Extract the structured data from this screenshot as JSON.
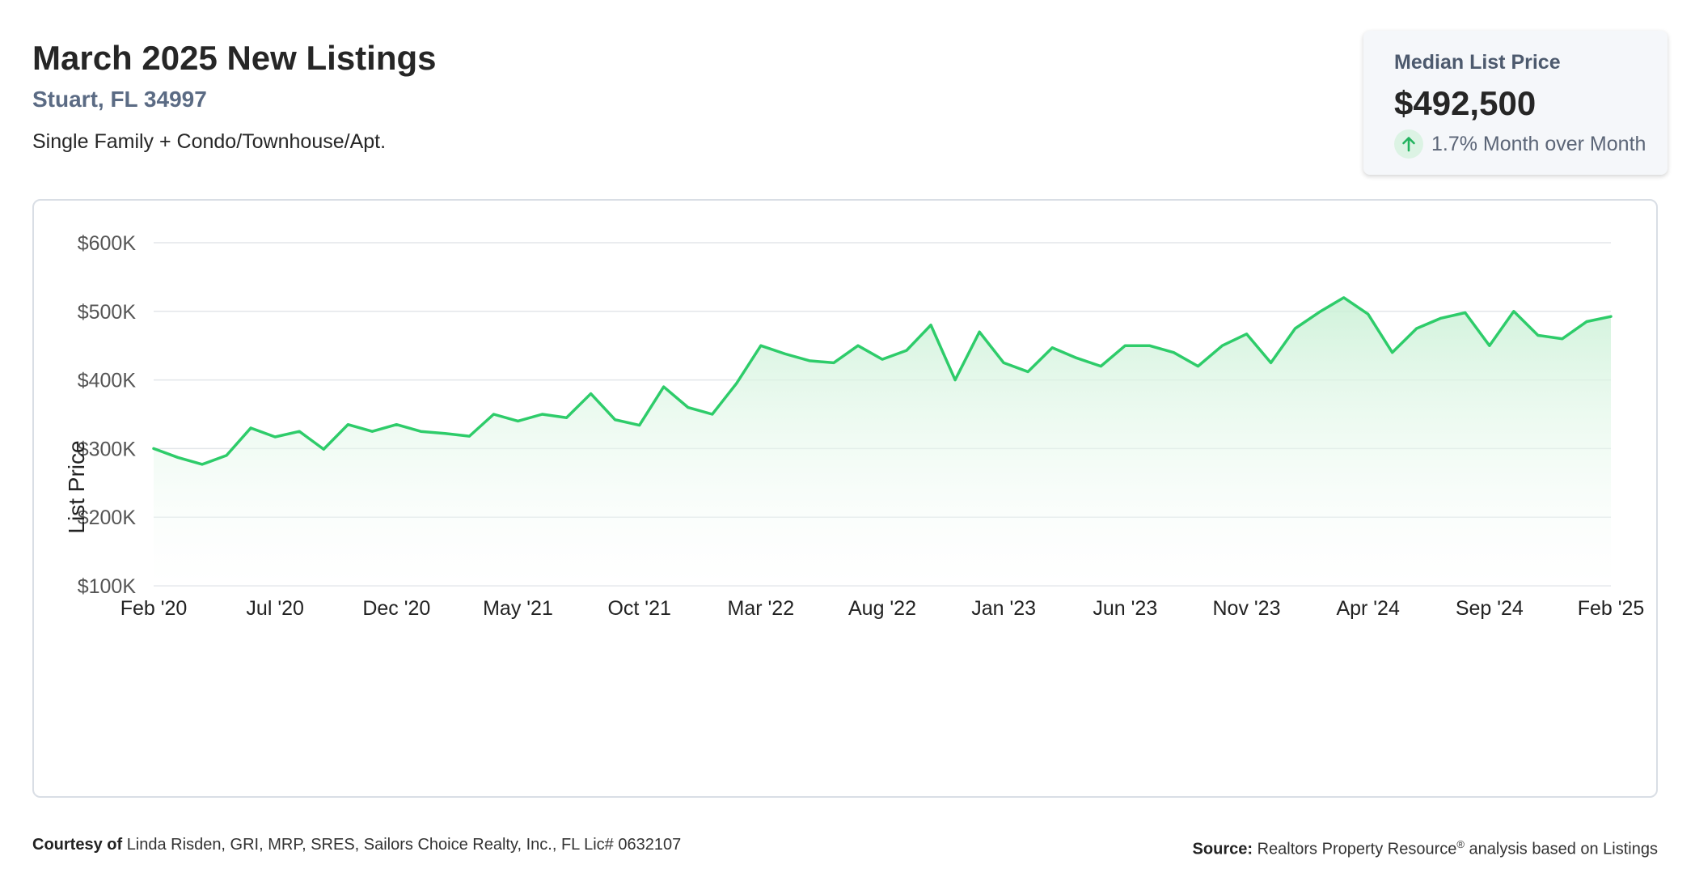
{
  "header": {
    "title": "March 2025 New Listings",
    "location": "Stuart, FL 34997",
    "property_type": "Single Family + Condo/Townhouse/Apt."
  },
  "metric_card": {
    "label": "Median List Price",
    "value": "$492,500",
    "change": "1.7% Month over Month",
    "change_icon": "arrow-up-icon",
    "change_color": "#22b35e"
  },
  "footer": {
    "courtesy_label": "Courtesy of",
    "courtesy_text": "Linda Risden, GRI, MRP, SRES, Sailors Choice Realty, Inc., FL Lic# 0632107",
    "source_label": "Source:",
    "source_name": "Realtors Property Resource",
    "source_mark": "®",
    "source_text": "analysis based on Listings"
  },
  "colors": {
    "line": "#2ecc6a",
    "fill_top": "#c8f0d4",
    "grid": "#e3e6ea"
  },
  "chart_data": {
    "type": "area",
    "ylabel": "List Price",
    "ylim": [
      100000,
      600000
    ],
    "y_ticks": [
      {
        "value": 600000,
        "label": "$600K"
      },
      {
        "value": 500000,
        "label": "$500K"
      },
      {
        "value": 400000,
        "label": "$400K"
      },
      {
        "value": 300000,
        "label": "$300K"
      },
      {
        "value": 200000,
        "label": "$200K"
      },
      {
        "value": 100000,
        "label": "$100K"
      }
    ],
    "x_ticks": [
      {
        "index": 0,
        "label": "Feb '20"
      },
      {
        "index": 5,
        "label": "Jul '20"
      },
      {
        "index": 10,
        "label": "Dec '20"
      },
      {
        "index": 15,
        "label": "May '21"
      },
      {
        "index": 20,
        "label": "Oct '21"
      },
      {
        "index": 25,
        "label": "Mar '22"
      },
      {
        "index": 30,
        "label": "Aug '22"
      },
      {
        "index": 35,
        "label": "Jan '23"
      },
      {
        "index": 40,
        "label": "Jun '23"
      },
      {
        "index": 45,
        "label": "Nov '23"
      },
      {
        "index": 50,
        "label": "Apr '24"
      },
      {
        "index": 55,
        "label": "Sep '24"
      },
      {
        "index": 60,
        "label": "Feb '25"
      }
    ],
    "grid": true,
    "legend": "none",
    "series": [
      {
        "values": [
          300000,
          287000,
          277000,
          290000,
          330000,
          317000,
          325000,
          299000,
          335000,
          325000,
          335000,
          325000,
          322000,
          318000,
          350000,
          340000,
          350000,
          345000,
          380000,
          342000,
          334000,
          390000,
          360000,
          350000,
          395000,
          450000,
          438000,
          428000,
          425000,
          450000,
          430000,
          443000,
          480000,
          400000,
          470000,
          425000,
          412000,
          447000,
          432000,
          420000,
          450000,
          450000,
          440000,
          420000,
          450000,
          467000,
          425000,
          475000,
          499000,
          520000,
          496000,
          440000,
          475000,
          490000,
          498000,
          450000,
          500000,
          465000,
          460000,
          485000,
          492500
        ]
      }
    ]
  }
}
